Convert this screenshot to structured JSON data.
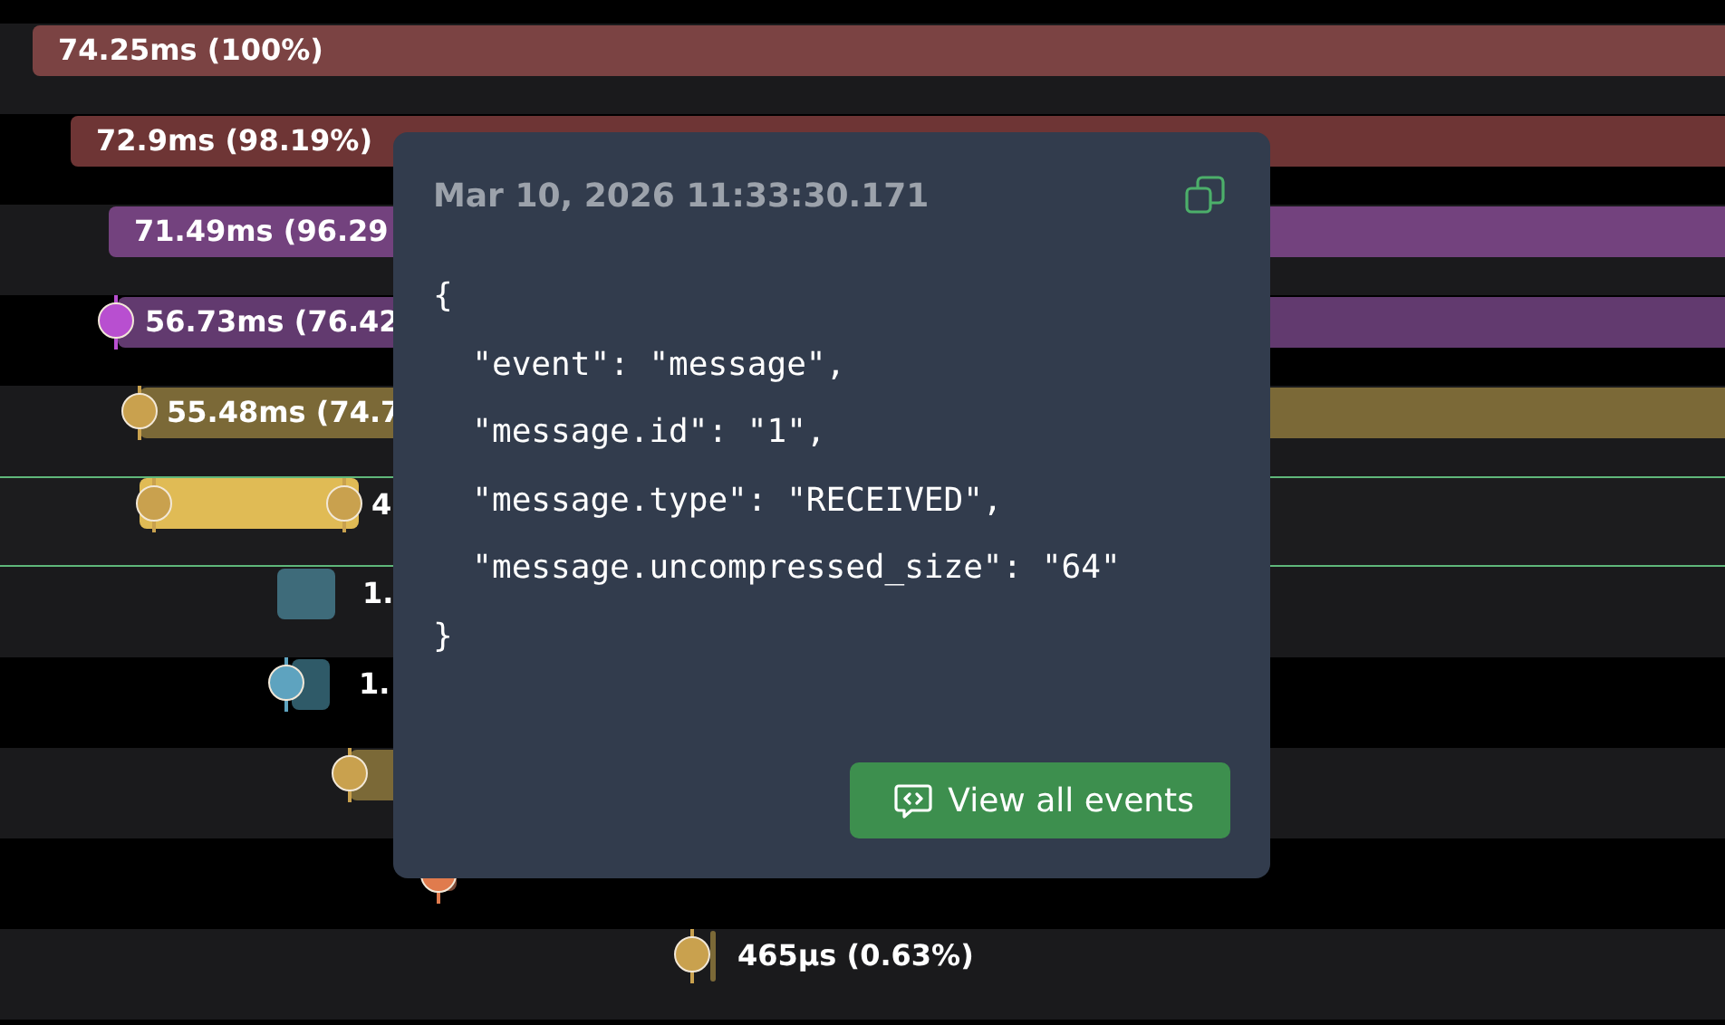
{
  "rows": [
    {
      "label": "74.25ms (100%)",
      "color": "#7b4343",
      "selected": false
    },
    {
      "label": "72.9ms (98.19%)",
      "color": "#6e3535",
      "selected": false
    },
    {
      "label": "71.49ms (96.29",
      "color": "#73427e",
      "selected": false
    },
    {
      "label": "56.73ms (76.42",
      "color": "#623a6f",
      "marker": {
        "color": "#b84fd0"
      },
      "selected": false
    },
    {
      "label": "55.48ms (74.7",
      "color": "#7b6937",
      "marker": {
        "color": "#c9a14e"
      },
      "selected": false
    },
    {
      "label": "4",
      "color": "#e0bb55",
      "marker": {
        "color": "#c9a14e"
      },
      "selected": true
    },
    {
      "label": "1.",
      "color": "#3e6b7a",
      "selected": false
    },
    {
      "label": "1.",
      "color": "#2f5a68",
      "marker": {
        "color": "#5ea3bf"
      },
      "selected": false
    },
    {
      "color": "#7b6937",
      "marker": {
        "color": "#c9a14e"
      },
      "selected": false
    },
    {
      "color": "#7b4a37",
      "marker": {
        "color": "#e07b4d"
      },
      "selected": false
    },
    {
      "label": "465µs (0.63%)",
      "color": "#7b6937",
      "marker": {
        "color": "#c9a14e"
      },
      "selected": false
    }
  ],
  "tooltip": {
    "timestamp": "Mar 10, 2026 11:33:30.171",
    "lines": [
      "{",
      "  \"event\": \"message\",",
      "  \"message.id\": \"1\",",
      "  \"message.type\": \"RECEIVED\",",
      "  \"message.uncompressed_size\": \"64\"",
      "}"
    ],
    "button": "View all events"
  }
}
